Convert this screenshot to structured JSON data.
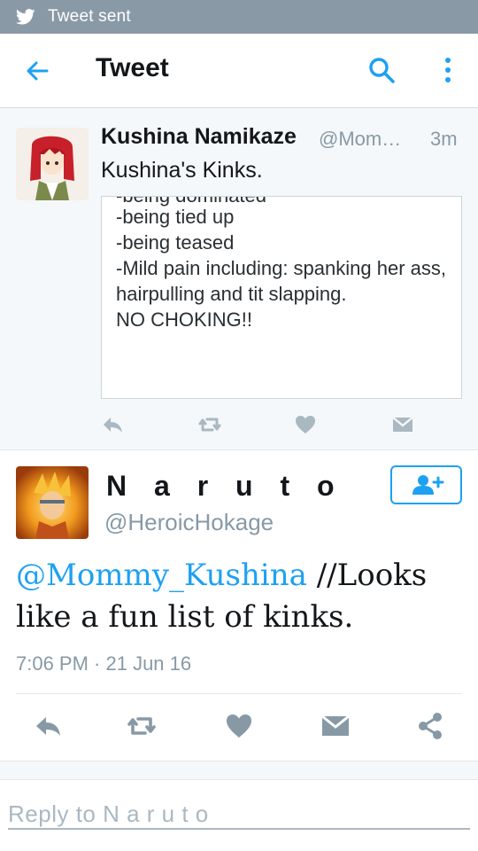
{
  "status_bar": {
    "text": "Tweet sent",
    "icon": "twitter-bird-icon"
  },
  "app_bar": {
    "title": "Tweet",
    "back_icon": "back-arrow-icon",
    "search_icon": "search-icon",
    "more_icon": "more-vertical-icon"
  },
  "parent_tweet": {
    "name": "Kushina Namikaze",
    "handle": "@Mom…",
    "time": "3m",
    "text": "Kushina's Kinks.",
    "card": {
      "cut_line": "-being dominated",
      "lines": [
        "-being tied up",
        "-being teased",
        "-Mild pain including: spanking her ass, hairpulling and tit slapping.",
        "NO CHOKING!!"
      ]
    }
  },
  "main_tweet": {
    "name": "N a r u t o",
    "handle": "@HeroicHokage",
    "mention": "@Mommy_Kushina",
    "text": " //Looks like a fun list of kinks.",
    "timestamp": "7:06 PM · 21 Jun 16"
  },
  "reply": {
    "placeholder": "Reply to N a r u t o"
  },
  "colors": {
    "accent": "#1da1f2",
    "status_bar": "#8a99a6",
    "secondary_text": "#8899a6"
  }
}
